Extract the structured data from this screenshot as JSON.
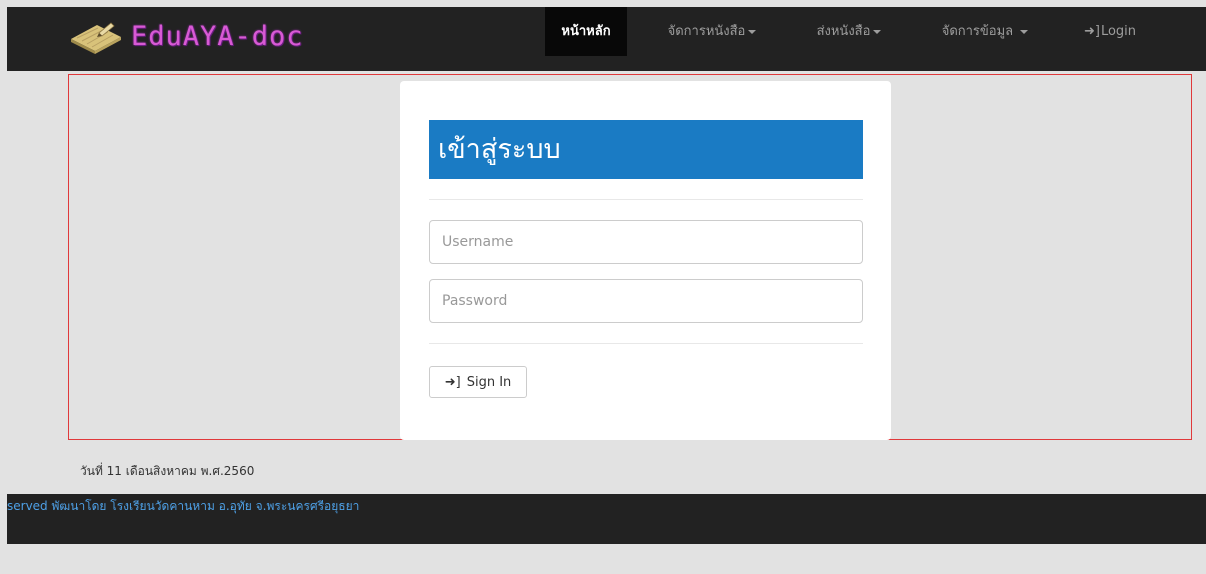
{
  "brand": {
    "name": "EduAYA-doc",
    "icon": "book-icon",
    "color": "#d85ad4"
  },
  "nav": {
    "home": "หน้าหลัก",
    "manage_books": "จัดการหนังสือ",
    "send_books": "ส่งหนังสือ",
    "manage_data": "จัดการข้อมูล",
    "login": "Login"
  },
  "login": {
    "title": "เข้าสู่ระบบ",
    "username_placeholder": "Username",
    "password_placeholder": "Password",
    "signin_label": "Sign In",
    "header_color": "#1a7bc4"
  },
  "date": "วันที่ 11 เดือนสิงหาคม พ.ศ.2560",
  "footer": {
    "text": "served  พัฒนาโดย โรงเรียนวัดคานหาม อ.อุทัย จ.พระนครศรีอยุธยา"
  }
}
